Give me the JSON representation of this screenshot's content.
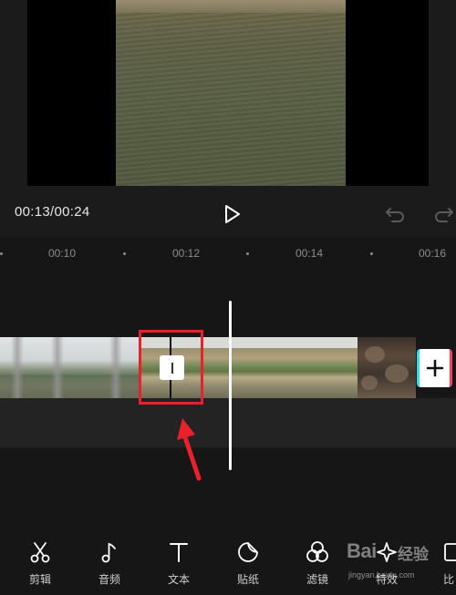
{
  "player": {
    "current_time": "00:13",
    "total_time": "00:24",
    "time_display": "00:13/00:24"
  },
  "ruler": {
    "ticks": [
      "00:10",
      "00:12",
      "00:14",
      "00:16"
    ]
  },
  "toolbar": {
    "items": [
      {
        "label": "剪辑",
        "icon": "scissors-icon"
      },
      {
        "label": "音频",
        "icon": "music-note-icon"
      },
      {
        "label": "文本",
        "icon": "text-icon"
      },
      {
        "label": "贴纸",
        "icon": "sticker-icon"
      },
      {
        "label": "滤镜",
        "icon": "filter-icon"
      },
      {
        "label": "特效",
        "icon": "effects-icon"
      },
      {
        "label": "比",
        "icon": "ratio-icon"
      }
    ]
  },
  "watermark": {
    "logo": "Bai",
    "brand": "经验",
    "url": "jingyan.baidu.com"
  },
  "colors": {
    "highlight": "#e8212c",
    "add_button_left": "#2de0e6",
    "add_button_right": "#ff3b5c"
  }
}
